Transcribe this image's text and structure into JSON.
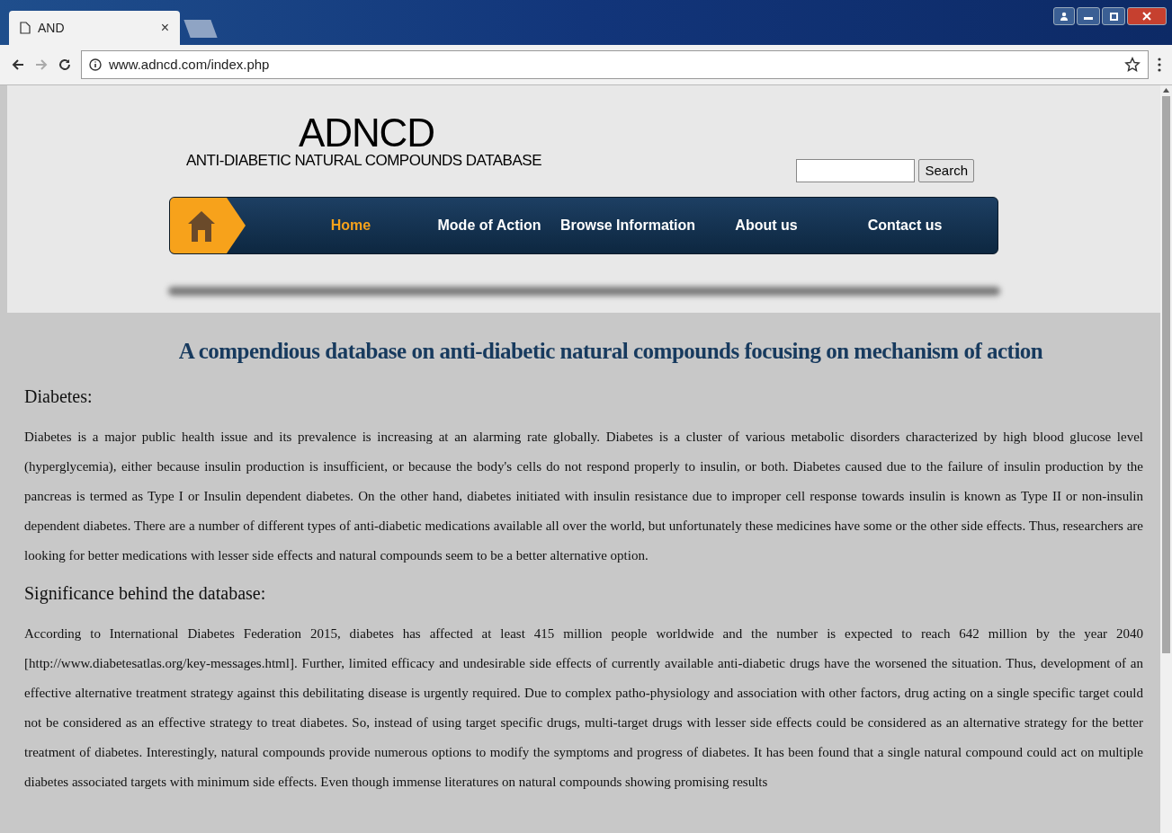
{
  "browser": {
    "tab": {
      "title": "AND",
      "close": "×"
    },
    "address": "www.adncd.com/index.php"
  },
  "site": {
    "logo": "ADNCD",
    "subtitle": "ANTI-DIABETIC NATURAL COMPOUNDS DATABASE",
    "search": {
      "button": "Search"
    },
    "nav": [
      {
        "label": "Home",
        "selected": true
      },
      {
        "label": "Mode of Action",
        "selected": false
      },
      {
        "label": "Browse Information",
        "selected": false
      },
      {
        "label": "About us",
        "selected": false
      },
      {
        "label": "Contact us",
        "selected": false
      }
    ]
  },
  "content": {
    "headline": "A compendious database on anti-diabetic natural compounds focusing on mechanism of action",
    "sections": [
      {
        "heading": "Diabetes:",
        "text": "Diabetes is a major public health issue and its prevalence is increasing at an alarming rate globally. Diabetes is a cluster of various metabolic disorders characterized by high blood glucose level (hyperglycemia), either because insulin production is insufficient, or because the body's cells do not respond properly to insulin, or both. Diabetes caused due to the failure of insulin production by the pancreas is termed as Type I or Insulin dependent diabetes. On the other hand, diabetes initiated with insulin resistance due to improper cell response towards insulin is known as Type II or non-insulin dependent diabetes. There are a number of different types of anti-diabetic medications available all over the world, but unfortunately these medicines have some or the other side effects. Thus, researchers are looking for better medications with lesser side effects and natural compounds seem to be a better alternative option."
      },
      {
        "heading": "Significance behind the database:",
        "text": "According to International Diabetes Federation 2015, diabetes has affected at least 415 million people worldwide and the number is expected to reach 642 million by the year 2040 [http://www.diabetesatlas.org/key-messages.html]. Further, limited efficacy and undesirable side effects of currently available anti-diabetic drugs have the worsened the situation. Thus, development of an effective alternative treatment strategy against this debilitating disease is urgently required. Due to complex patho-physiology and association with other factors, drug acting on a single specific target could not be considered as an effective strategy to treat diabetes. So, instead of using target specific drugs, multi-target drugs with lesser side effects could be considered as an alternative strategy for the better treatment of diabetes. Interestingly, natural compounds provide numerous options to modify the symptoms and progress of diabetes. It has been found that a single natural compound could act on multiple diabetes associated targets with minimum side effects. Even though immense literatures on natural compounds showing promising results"
      }
    ]
  }
}
